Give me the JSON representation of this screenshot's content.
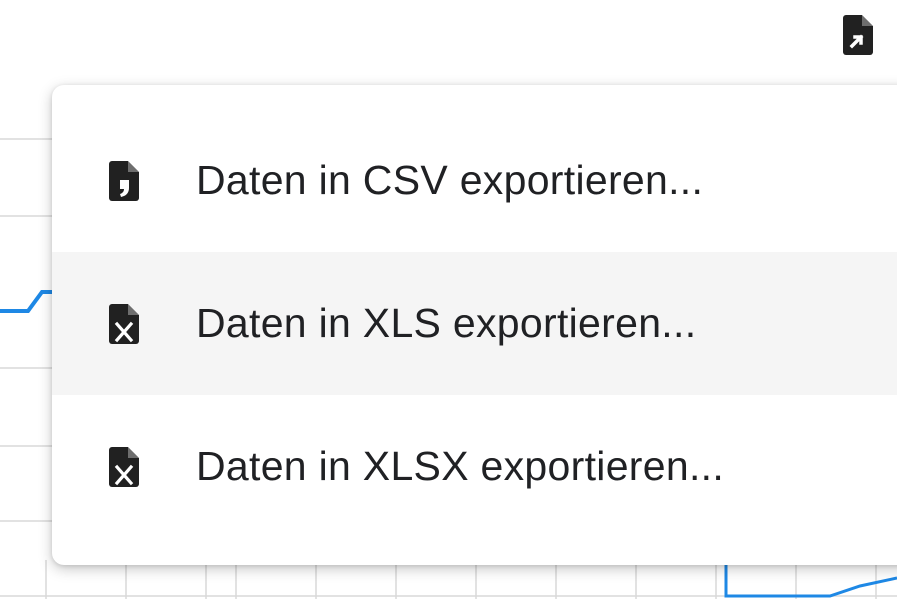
{
  "export_menu": {
    "trigger_icon": "file-export-icon",
    "items": [
      {
        "label": "Daten in CSV exportieren...",
        "icon": "csv-file-icon",
        "hovered": false
      },
      {
        "label": "Daten in XLS exportieren...",
        "icon": "excel-file-icon",
        "hovered": true
      },
      {
        "label": "Daten in XLSX exportieren...",
        "icon": "excel-file-icon",
        "hovered": false
      }
    ]
  },
  "colors": {
    "menu_background": "#ffffff",
    "hover_background": "#f5f5f5",
    "text": "#202124",
    "icon": "#212121",
    "chart_line": "#1e88e5",
    "grid": "#d9d9d9"
  }
}
